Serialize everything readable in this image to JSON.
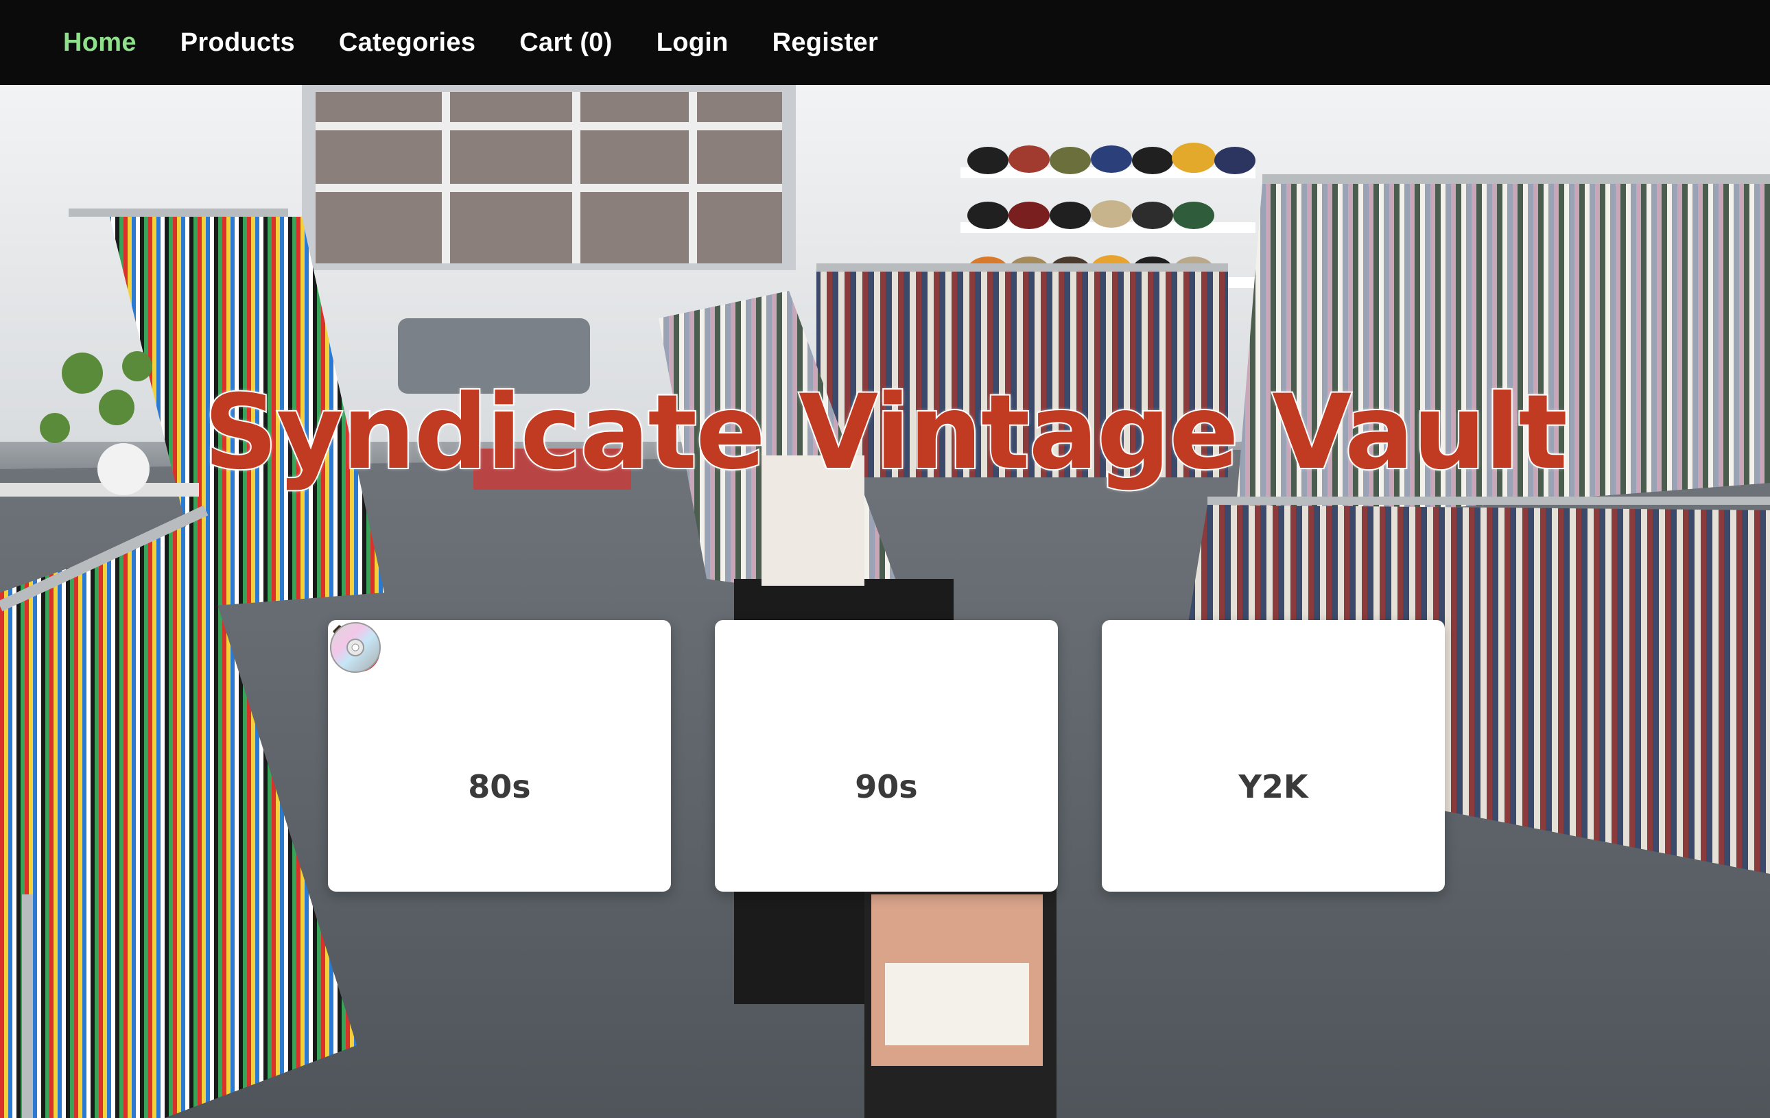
{
  "nav": {
    "items": [
      {
        "label": "Home",
        "active": true
      },
      {
        "label": "Products",
        "active": false
      },
      {
        "label": "Categories",
        "active": false
      },
      {
        "label": "Cart (0)",
        "active": false
      },
      {
        "label": "Login",
        "active": false
      },
      {
        "label": "Register",
        "active": false
      }
    ],
    "active_color": "#8ee08a",
    "background": "#0b0b0b"
  },
  "hero": {
    "title": "Syndicate Vintage Vault",
    "title_color": "#c13a22",
    "background_scene": "vintage-clothing-store-photo"
  },
  "eras": [
    {
      "label": "80s",
      "icon": "guitar-icon"
    },
    {
      "label": "90s",
      "icon": "microphone-icon"
    },
    {
      "label": "Y2K",
      "icon": "cd-icon"
    }
  ]
}
